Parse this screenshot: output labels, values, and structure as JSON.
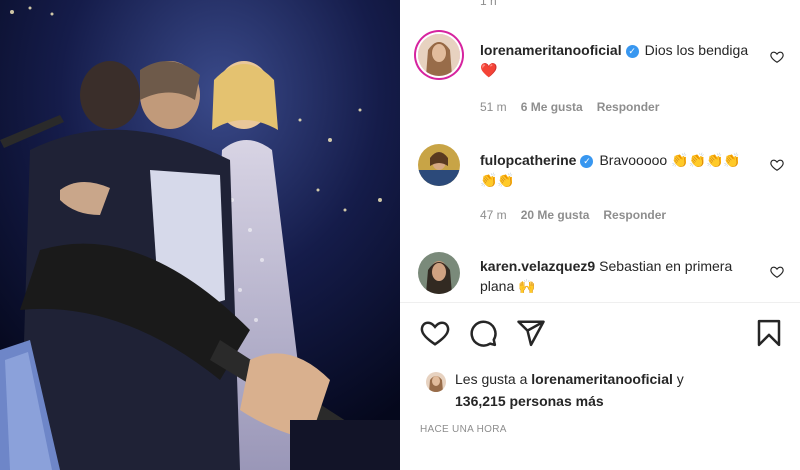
{
  "top_stub": "1 h",
  "comments": [
    {
      "username": "lorenameritanooficial",
      "verified": true,
      "text": "Dios los bendiga ❤️",
      "time": "51 m",
      "likes": "6 Me gusta",
      "reply": "Responder",
      "avatar_color": "#c99a6b"
    },
    {
      "username": "fulopcatherine",
      "verified": true,
      "text": "Bravooooo 👏👏👏👏👏👏",
      "time": "47 m",
      "likes": "20 Me gusta",
      "reply": "Responder",
      "avatar_color": "#b08a3e"
    },
    {
      "username": "karen.velazquez9",
      "verified": false,
      "text": "Sebastian en primera plana 🙌",
      "avatar_color": "#5b4a3a"
    }
  ],
  "actions": {
    "like_icon": "heart-icon",
    "comment_icon": "comment-icon",
    "share_icon": "share-icon",
    "save_icon": "bookmark-icon"
  },
  "likes_summary": {
    "prefix": "Les gusta a ",
    "username": "lorenameritanooficial",
    "middle": " y",
    "count": "136,215",
    "suffix": " personas más"
  },
  "posted_ago": "HACE UNA HORA",
  "colors": {
    "text": "#262626",
    "muted": "#8e8e8e",
    "verified": "#3897f0",
    "heart_red": "#ed4956"
  }
}
